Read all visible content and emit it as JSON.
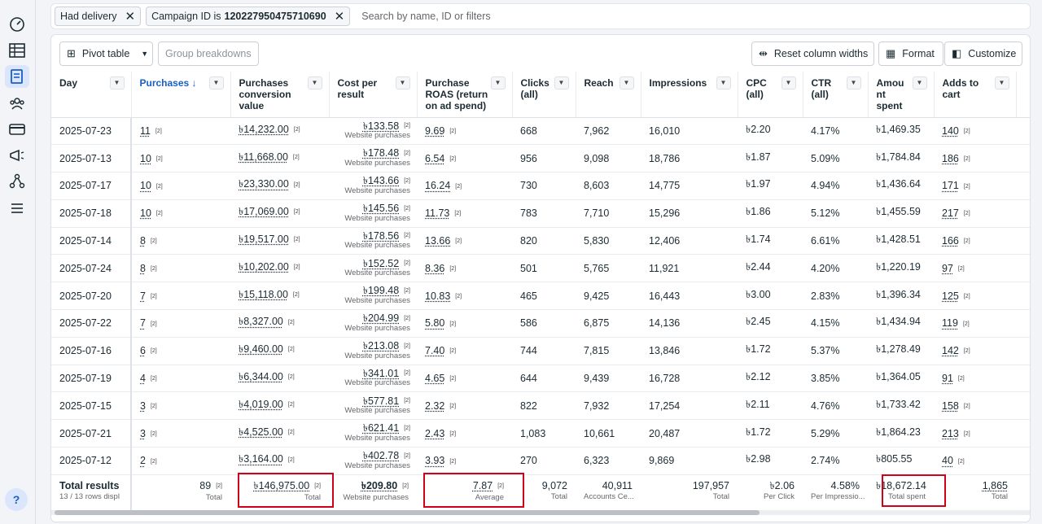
{
  "filters": {
    "chip1": "Had delivery",
    "chip2_prefix": "Campaign ID is",
    "chip2_value": "120227950475710690",
    "search_placeholder": "Search by name, ID or filters"
  },
  "toolbar": {
    "pivot_table": "Pivot table",
    "group_breakdowns": "Group breakdowns",
    "reset_widths": "Reset column widths",
    "format": "Format",
    "customize": "Customize"
  },
  "columns": [
    "Day",
    "Purchases ↓",
    "Purchases conversion value",
    "Cost per result",
    "Purchase ROAS (return on ad spend)",
    "Clicks (all)",
    "Reach",
    "Impressions",
    "CPC (all)",
    "CTR (all)",
    "Amou nt spent",
    "Adds to cart"
  ],
  "footnote": "[2]",
  "cost_sub": "Website purchases",
  "rows": [
    {
      "day": "2025-07-23",
      "purchases": "11",
      "conv": "৳14,232.00",
      "cost": "৳133.58",
      "roas": "9.69",
      "clicks": "668",
      "reach": "7,962",
      "impr": "16,010",
      "cpc": "৳2.20",
      "ctr": "4.17%",
      "spent": "৳1,469.35",
      "atc": "140"
    },
    {
      "day": "2025-07-13",
      "purchases": "10",
      "conv": "৳11,668.00",
      "cost": "৳178.48",
      "roas": "6.54",
      "clicks": "956",
      "reach": "9,098",
      "impr": "18,786",
      "cpc": "৳1.87",
      "ctr": "5.09%",
      "spent": "৳1,784.84",
      "atc": "186"
    },
    {
      "day": "2025-07-17",
      "purchases": "10",
      "conv": "৳23,330.00",
      "cost": "৳143.66",
      "roas": "16.24",
      "clicks": "730",
      "reach": "8,603",
      "impr": "14,775",
      "cpc": "৳1.97",
      "ctr": "4.94%",
      "spent": "৳1,436.64",
      "atc": "171"
    },
    {
      "day": "2025-07-18",
      "purchases": "10",
      "conv": "৳17,069.00",
      "cost": "৳145.56",
      "roas": "11.73",
      "clicks": "783",
      "reach": "7,710",
      "impr": "15,296",
      "cpc": "৳1.86",
      "ctr": "5.12%",
      "spent": "৳1,455.59",
      "atc": "217"
    },
    {
      "day": "2025-07-14",
      "purchases": "8",
      "conv": "৳19,517.00",
      "cost": "৳178.56",
      "roas": "13.66",
      "clicks": "820",
      "reach": "5,830",
      "impr": "12,406",
      "cpc": "৳1.74",
      "ctr": "6.61%",
      "spent": "৳1,428.51",
      "atc": "166"
    },
    {
      "day": "2025-07-24",
      "purchases": "8",
      "conv": "৳10,202.00",
      "cost": "৳152.52",
      "roas": "8.36",
      "clicks": "501",
      "reach": "5,765",
      "impr": "11,921",
      "cpc": "৳2.44",
      "ctr": "4.20%",
      "spent": "৳1,220.19",
      "atc": "97"
    },
    {
      "day": "2025-07-20",
      "purchases": "7",
      "conv": "৳15,118.00",
      "cost": "৳199.48",
      "roas": "10.83",
      "clicks": "465",
      "reach": "9,425",
      "impr": "16,443",
      "cpc": "৳3.00",
      "ctr": "2.83%",
      "spent": "৳1,396.34",
      "atc": "125"
    },
    {
      "day": "2025-07-22",
      "purchases": "7",
      "conv": "৳8,327.00",
      "cost": "৳204.99",
      "roas": "5.80",
      "clicks": "586",
      "reach": "6,875",
      "impr": "14,136",
      "cpc": "৳2.45",
      "ctr": "4.15%",
      "spent": "৳1,434.94",
      "atc": "119"
    },
    {
      "day": "2025-07-16",
      "purchases": "6",
      "conv": "৳9,460.00",
      "cost": "৳213.08",
      "roas": "7.40",
      "clicks": "744",
      "reach": "7,815",
      "impr": "13,846",
      "cpc": "৳1.72",
      "ctr": "5.37%",
      "spent": "৳1,278.49",
      "atc": "142"
    },
    {
      "day": "2025-07-19",
      "purchases": "4",
      "conv": "৳6,344.00",
      "cost": "৳341.01",
      "roas": "4.65",
      "clicks": "644",
      "reach": "9,439",
      "impr": "16,728",
      "cpc": "৳2.12",
      "ctr": "3.85%",
      "spent": "৳1,364.05",
      "atc": "91"
    },
    {
      "day": "2025-07-15",
      "purchases": "3",
      "conv": "৳4,019.00",
      "cost": "৳577.81",
      "roas": "2.32",
      "clicks": "822",
      "reach": "7,932",
      "impr": "17,254",
      "cpc": "৳2.11",
      "ctr": "4.76%",
      "spent": "৳1,733.42",
      "atc": "158"
    },
    {
      "day": "2025-07-21",
      "purchases": "3",
      "conv": "৳4,525.00",
      "cost": "৳621.41",
      "roas": "2.43",
      "clicks": "1,083",
      "reach": "10,661",
      "impr": "20,487",
      "cpc": "৳1.72",
      "ctr": "5.29%",
      "spent": "৳1,864.23",
      "atc": "213"
    },
    {
      "day": "2025-07-12",
      "purchases": "2",
      "conv": "৳3,164.00",
      "cost": "৳402.78",
      "roas": "3.93",
      "clicks": "270",
      "reach": "6,323",
      "impr": "9,869",
      "cpc": "৳2.98",
      "ctr": "2.74%",
      "spent": "৳805.55",
      "atc": "40"
    }
  ],
  "totals": {
    "label": "Total results",
    "sub": "13 / 13 rows displ",
    "purchases": "89",
    "purchases_sub": "Total",
    "conv": "৳146,975.00",
    "conv_sub": "Total",
    "cost": "৳209.80",
    "cost_sub": "Website purchases",
    "roas": "7.87",
    "roas_sub": "Average",
    "clicks": "9,072",
    "clicks_sub": "Total",
    "reach": "40,911",
    "reach_sub": "Accounts Ce...",
    "impr": "197,957",
    "impr_sub": "Total",
    "cpc": "৳2.06",
    "cpc_sub": "Per Click",
    "ctr": "4.58%",
    "ctr_sub": "Per Impressio...",
    "spent": "৳18,672.14",
    "spent_sub": "Total spent",
    "atc": "1,865",
    "atc_sub": "Total"
  },
  "colors": {
    "accent": "#1a5ec4",
    "highlight": "#d0021b"
  }
}
